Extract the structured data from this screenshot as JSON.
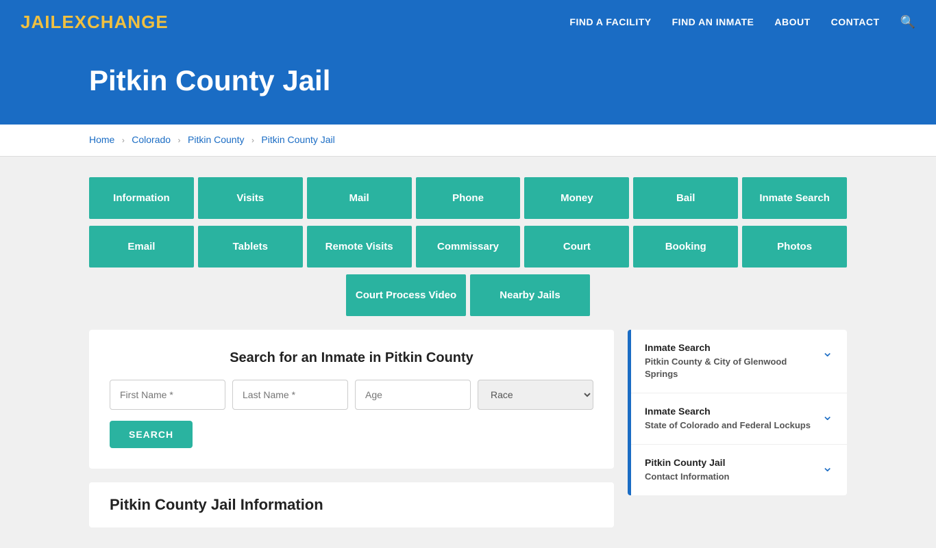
{
  "nav": {
    "logo_jail": "JAIL",
    "logo_exchange": "EXCHANGE",
    "links": [
      {
        "label": "FIND A FACILITY",
        "href": "#"
      },
      {
        "label": "FIND AN INMATE",
        "href": "#"
      },
      {
        "label": "ABOUT",
        "href": "#"
      },
      {
        "label": "CONTACT",
        "href": "#"
      }
    ]
  },
  "hero": {
    "title": "Pitkin County Jail"
  },
  "breadcrumb": {
    "items": [
      {
        "label": "Home",
        "href": "#"
      },
      {
        "label": "Colorado",
        "href": "#"
      },
      {
        "label": "Pitkin County",
        "href": "#"
      },
      {
        "label": "Pitkin County Jail",
        "href": "#"
      }
    ]
  },
  "buttons_row1": [
    {
      "label": "Information"
    },
    {
      "label": "Visits"
    },
    {
      "label": "Mail"
    },
    {
      "label": "Phone"
    },
    {
      "label": "Money"
    },
    {
      "label": "Bail"
    },
    {
      "label": "Inmate Search"
    }
  ],
  "buttons_row2": [
    {
      "label": "Email"
    },
    {
      "label": "Tablets"
    },
    {
      "label": "Remote Visits"
    },
    {
      "label": "Commissary"
    },
    {
      "label": "Court"
    },
    {
      "label": "Booking"
    },
    {
      "label": "Photos"
    }
  ],
  "buttons_row3": [
    {
      "label": "Court Process Video"
    },
    {
      "label": "Nearby Jails"
    }
  ],
  "search": {
    "title": "Search for an Inmate in Pitkin County",
    "first_name_placeholder": "First Name *",
    "last_name_placeholder": "Last Name *",
    "age_placeholder": "Age",
    "race_placeholder": "Race",
    "button_label": "SEARCH"
  },
  "info": {
    "title": "Pitkin County Jail Information"
  },
  "sidebar": {
    "items": [
      {
        "title": "Inmate Search",
        "subtitle": "Pitkin County & City of Glenwood Springs"
      },
      {
        "title": "Inmate Search",
        "subtitle": "State of Colorado and Federal Lockups"
      },
      {
        "title": "Pitkin County Jail",
        "subtitle": "Contact Information"
      }
    ]
  }
}
